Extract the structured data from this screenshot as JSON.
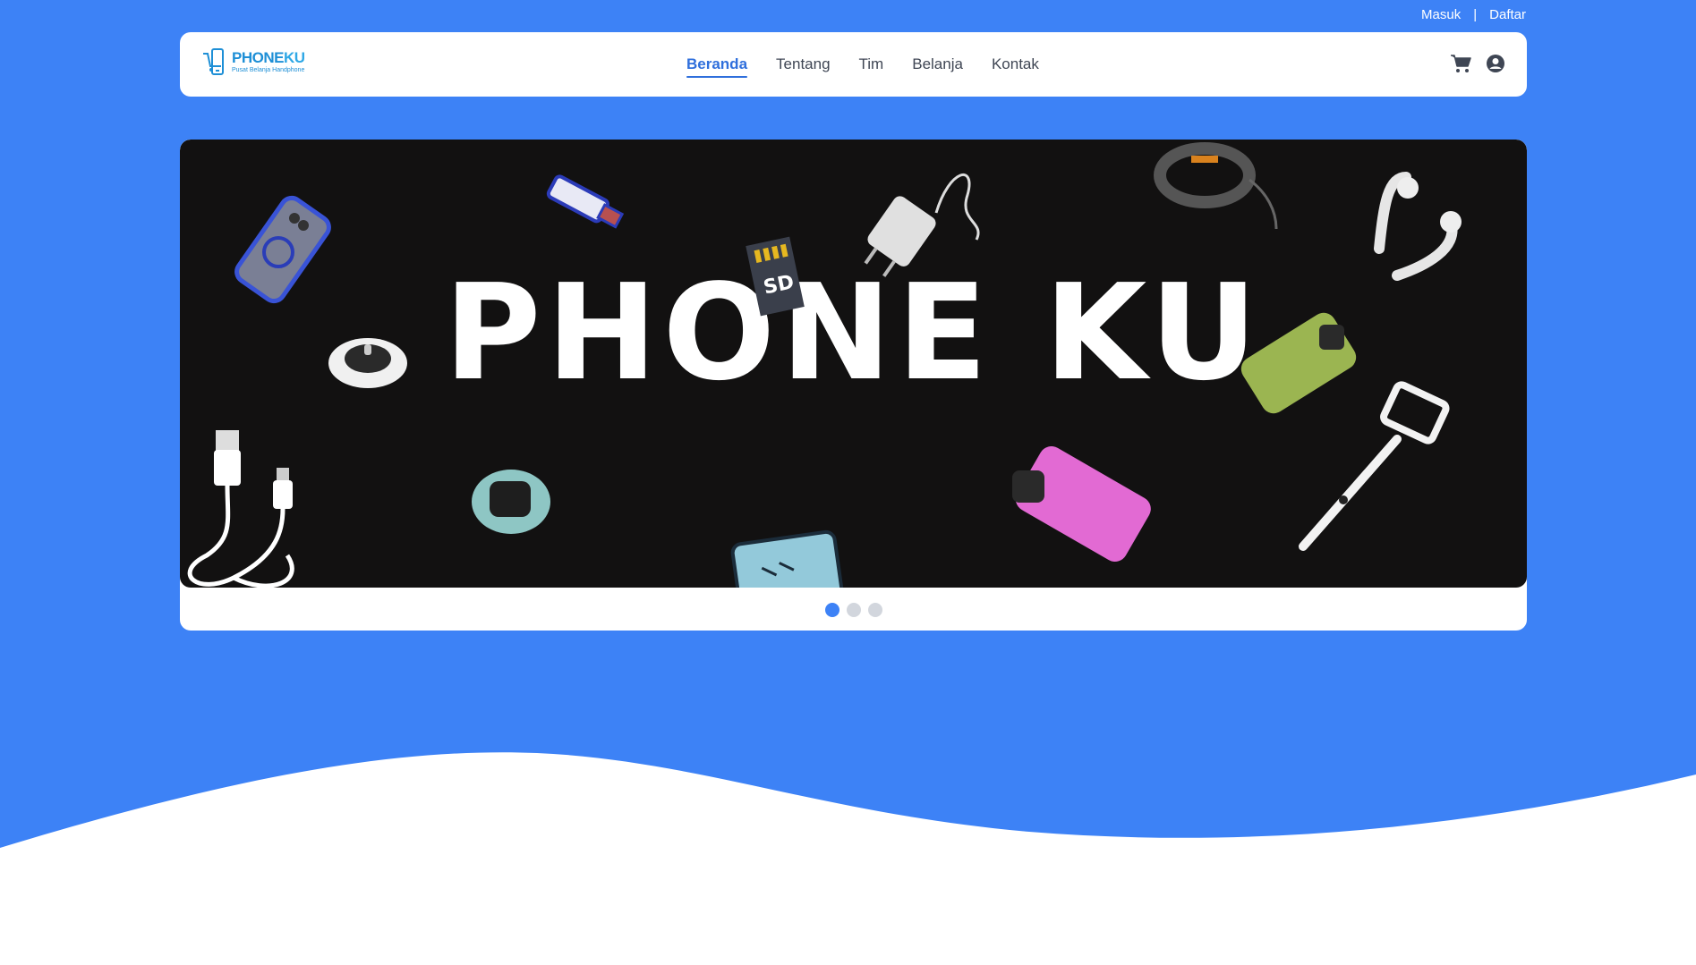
{
  "auth": {
    "login": "Masuk",
    "separator": "|",
    "register": "Daftar"
  },
  "brand": {
    "name_a": "PHONE",
    "name_b": "KU",
    "tagline": "Pusat Belanja Handphone"
  },
  "nav": {
    "items": [
      {
        "label": "Beranda",
        "active": true
      },
      {
        "label": "Tentang",
        "active": false
      },
      {
        "label": "Tim",
        "active": false
      },
      {
        "label": "Belanja",
        "active": false
      },
      {
        "label": "Kontak",
        "active": false
      }
    ],
    "icons": [
      "cart-icon",
      "user-circle-icon"
    ]
  },
  "hero": {
    "title": "PHONE KU",
    "sd_card_label": "SD"
  },
  "carousel": {
    "slide_count": 3,
    "active_index": 0
  },
  "colors": {
    "primary": "#3d82f6",
    "nav_active": "#2f6fdc",
    "slide_bg": "#121111",
    "dot_inactive": "#d2d6dd"
  }
}
